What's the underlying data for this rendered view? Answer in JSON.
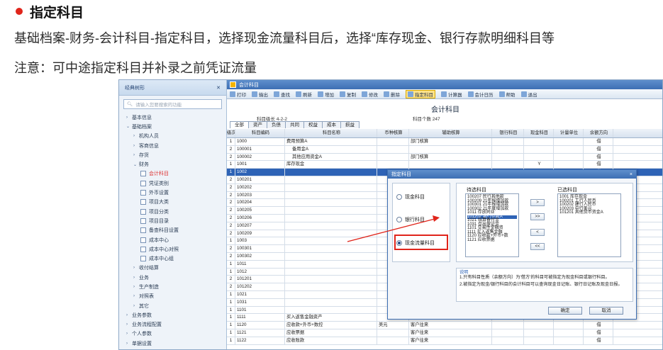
{
  "article": {
    "heading": "指定科目",
    "line1": "基础档案-财务-会计科目-指定科目，选择现金流量科目后，选择“库存现金、银行存款明细科目等",
    "line2": "注意：可中途指定科目并补录之前凭证流量"
  },
  "sidebar": {
    "title": "经典树形",
    "pin": "✕",
    "search_placeholder": "请输入您要搜索的功能",
    "items": [
      {
        "label": "基本信息",
        "indent": 0,
        "caret": "›"
      },
      {
        "label": "基础档案",
        "indent": 0,
        "caret": "⌄"
      },
      {
        "label": "机构人员",
        "indent": 1,
        "caret": "›"
      },
      {
        "label": "客商信息",
        "indent": 1,
        "caret": "›"
      },
      {
        "label": "存货",
        "indent": 1,
        "caret": "›"
      },
      {
        "label": "财务",
        "indent": 1,
        "caret": "⌄"
      },
      {
        "label": "会计科目",
        "indent": 2,
        "doc": true,
        "active": true
      },
      {
        "label": "凭证类别",
        "indent": 2,
        "doc": true
      },
      {
        "label": "外币设置",
        "indent": 2,
        "doc": true
      },
      {
        "label": "项目大类",
        "indent": 2,
        "doc": true
      },
      {
        "label": "项目分类",
        "indent": 2,
        "doc": true
      },
      {
        "label": "项目目录",
        "indent": 2,
        "doc": true
      },
      {
        "label": "备查科目设置",
        "indent": 2,
        "doc": true
      },
      {
        "label": "成本中心",
        "indent": 2,
        "doc": true
      },
      {
        "label": "成本中心对照",
        "indent": 2,
        "doc": true
      },
      {
        "label": "成本中心组",
        "indent": 2,
        "doc": true
      },
      {
        "label": "收付结算",
        "indent": 1,
        "caret": "›"
      },
      {
        "label": "业务",
        "indent": 1,
        "caret": "›"
      },
      {
        "label": "生产制造",
        "indent": 1,
        "caret": "›"
      },
      {
        "label": "对照表",
        "indent": 1,
        "caret": "›"
      },
      {
        "label": "其它",
        "indent": 1,
        "caret": "›"
      },
      {
        "label": "业务参数",
        "indent": 0,
        "caret": "›"
      },
      {
        "label": "业务流程配置",
        "indent": 0,
        "caret": "›"
      },
      {
        "label": "个人参数",
        "indent": 0,
        "caret": "›"
      },
      {
        "label": "单据设置",
        "indent": 0,
        "caret": "›"
      },
      {
        "label": "档案设置",
        "indent": 0,
        "caret": "›"
      }
    ]
  },
  "window_title": "会计科目",
  "toolbar": [
    "打印",
    "输出",
    "查找",
    "刷新",
    "增加",
    "复制",
    "修改",
    "删除",
    "指定科目",
    "计算器",
    "会计日历",
    "帮助",
    "退出"
  ],
  "toolbar_active": "指定科目",
  "report": {
    "title": "会计科目",
    "level_info": "科目级长  4-2-2",
    "count_info": "科目个数 247",
    "tabs": [
      "全部",
      "资产",
      "负债",
      "共同",
      "权益",
      "成本",
      "损益"
    ]
  },
  "grid": {
    "headers": [
      "级次",
      "科目编码",
      "科目名称",
      "币种核算",
      "辅助核算",
      "银行科目",
      "现金科目",
      "计量单位",
      "余额方向"
    ],
    "rows": [
      [
        "1",
        "1000",
        "费用预算A",
        "",
        "部门核算",
        "",
        "",
        "",
        "借"
      ],
      [
        "2",
        "100001",
        "备用金A",
        "",
        "",
        "",
        "",
        "",
        "借"
      ],
      [
        "2",
        "100002",
        "其他应用资金A",
        "",
        "部门核算",
        "",
        "",
        "",
        "借"
      ],
      [
        "1",
        "1001",
        "库存现金",
        "",
        "",
        "",
        "Y",
        "",
        "借"
      ],
      [
        "1",
        "1002",
        "",
        "",
        "",
        "",
        "",
        "",
        "借"
      ],
      [
        "2",
        "100201",
        "",
        "",
        "",
        "",
        "",
        "",
        "借"
      ],
      [
        "2",
        "100202",
        "",
        "",
        "",
        "",
        "",
        "",
        "借"
      ],
      [
        "2",
        "100203",
        "",
        "",
        "",
        "",
        "",
        "",
        "借"
      ],
      [
        "2",
        "100204",
        "",
        "",
        "",
        "",
        "",
        "",
        "借"
      ],
      [
        "2",
        "100205",
        "",
        "",
        "",
        "",
        "",
        "",
        "借"
      ],
      [
        "2",
        "100206",
        "",
        "",
        "",
        "",
        "",
        "",
        "借"
      ],
      [
        "2",
        "100207",
        "",
        "",
        "",
        "",
        "",
        "",
        "借"
      ],
      [
        "2",
        "100209",
        "",
        "",
        "",
        "",
        "",
        "",
        "借"
      ],
      [
        "1",
        "1003",
        "",
        "",
        "",
        "",
        "",
        "",
        "借"
      ],
      [
        "2",
        "100301",
        "",
        "",
        "",
        "",
        "",
        "",
        "借"
      ],
      [
        "2",
        "100302",
        "",
        "",
        "",
        "",
        "",
        "",
        "借"
      ],
      [
        "1",
        "1011",
        "",
        "",
        "",
        "",
        "",
        "",
        "借"
      ],
      [
        "1",
        "1012",
        "",
        "",
        "",
        "",
        "",
        "",
        "借"
      ],
      [
        "2",
        "101201",
        "",
        "",
        "",
        "",
        "",
        "",
        "借"
      ],
      [
        "2",
        "101202",
        "",
        "",
        "",
        "",
        "",
        "",
        "借"
      ],
      [
        "1",
        "1021",
        "",
        "",
        "",
        "",
        "",
        "",
        "借"
      ],
      [
        "1",
        "1031",
        "",
        "",
        "",
        "",
        "",
        "",
        "借"
      ],
      [
        "1",
        "1101",
        "",
        "",
        "",
        "",
        "",
        "",
        "借"
      ],
      [
        "1",
        "1111",
        "买入返售金融资产",
        "",
        "",
        "",
        "",
        "",
        "借"
      ],
      [
        "1",
        "1120",
        "应收款+外币+数控",
        "美元",
        "客户往来",
        "",
        "",
        "",
        "借"
      ],
      [
        "1",
        "1121",
        "应收票据",
        "",
        "客户往来",
        "",
        "",
        "",
        "借"
      ],
      [
        "1",
        "1122",
        "应收账款",
        "",
        "客户往来",
        "",
        "",
        "",
        "借"
      ]
    ]
  },
  "dialog": {
    "title": "指定科目",
    "close": "×",
    "options": [
      "现金科目",
      "银行科目",
      "现金流量科目"
    ],
    "selected_option": "现金流量科目",
    "candidate_label": "待选科目",
    "selected_label": "已选科目",
    "candidates": [
      "100207  民行其他款",
      "100209  21年报增加款",
      "100301  21年报增加款",
      "100302  21年度增加款",
      "1011  存放同业",
      "101202  银行存款A",
      "1021  结算备付金",
      "1031  存出保证金",
      "1101  交易性金融资",
      "1111  买入返售金融",
      "1120  应收款+外币+数",
      "1121  应收票据"
    ],
    "selected": [
      "1001  库存现金",
      "100201  工行人民币",
      "100202  建行人民币",
      "100203  中行美元",
      "101201  其他货币资金A"
    ],
    "move_buttons": [
      ">",
      ">>",
      "<",
      "<<"
    ],
    "note_title": "说明",
    "note_1": "1.只有科目性质（余额方向）为'借方'的科目可被指定为现金科目或银行科目。",
    "note_2": "2.被指定为现金/银行科目的会计科目可以查询现金日记账、银行日记账及现金日报。",
    "ok": "确定",
    "cancel": "取消"
  },
  "colors": {
    "accent": "#3d6fb4",
    "selection": "#2e63b6",
    "annotation": "#e0251b"
  }
}
